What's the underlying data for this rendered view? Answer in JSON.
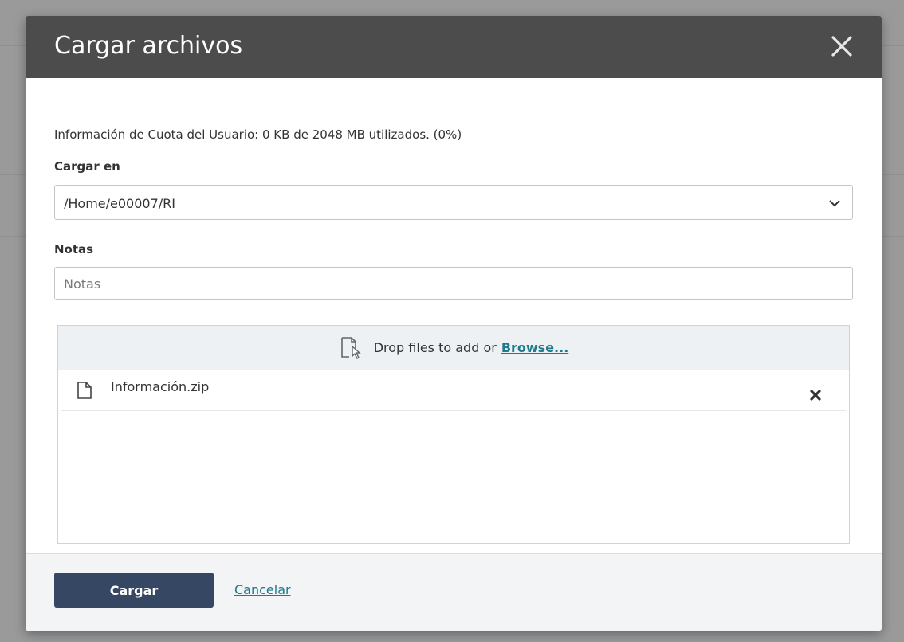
{
  "dialog": {
    "title": "Cargar archivos",
    "quota_text": "Información de Cuota del Usuario: 0 KB de 2048 MB utilizados. (0%)",
    "upload_to_label": "Cargar en",
    "upload_to_value": "/Home/e00007/RI",
    "notes_label": "Notas",
    "notes_placeholder": "Notas",
    "notes_value": ""
  },
  "dropzone": {
    "drop_text": "Drop files to add or",
    "browse_label": "Browse...",
    "files": [
      {
        "name": "Información.zip"
      }
    ]
  },
  "footer": {
    "submit_label": "Cargar",
    "cancel_label": "Cancelar"
  },
  "colors": {
    "header_bg": "#4c4c4c",
    "primary_button": "#354763",
    "link": "#1f7a8c",
    "footer_bg": "#f2f4f5"
  },
  "icons": {
    "close": "close-icon",
    "dropdown": "chevron-down-icon",
    "drop": "file-drop-icon",
    "file": "file-icon",
    "remove": "remove-icon"
  }
}
